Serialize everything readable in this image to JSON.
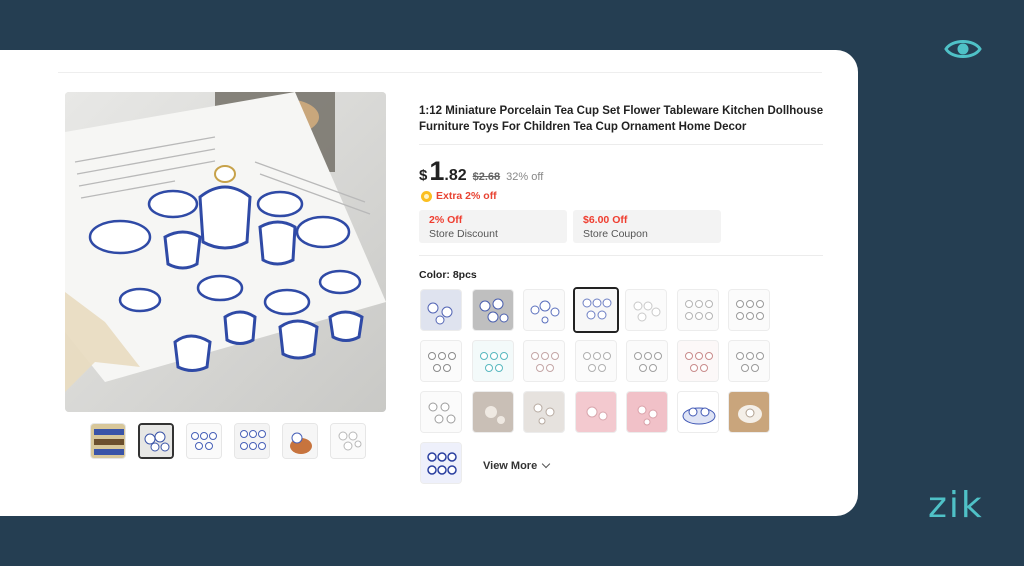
{
  "brand": {
    "name": "zik"
  },
  "product": {
    "title": "1:12 Miniature Porcelain Tea Cup Set Flower Tableware Kitchen Dollhouse Furniture Toys For Children Tea Cup Ornament Home Decor",
    "price": {
      "currency": "$",
      "integer": "1",
      "decimal": ".82",
      "original": "$2.68",
      "discount": "32% off"
    },
    "extra": "Extra 2% off",
    "coupons": [
      {
        "title": "2% Off",
        "label": "Store Discount"
      },
      {
        "title": "$6.00 Off",
        "label": "Store Coupon"
      }
    ],
    "color_label": "Color: 8pcs",
    "view_more": "View More"
  },
  "colors": {
    "accent": "#4fc1c7",
    "price_red": "#ef3d2f",
    "background": "#253e52"
  },
  "icons": [
    "eye-icon",
    "coin-icon",
    "chevron-down-icon"
  ]
}
